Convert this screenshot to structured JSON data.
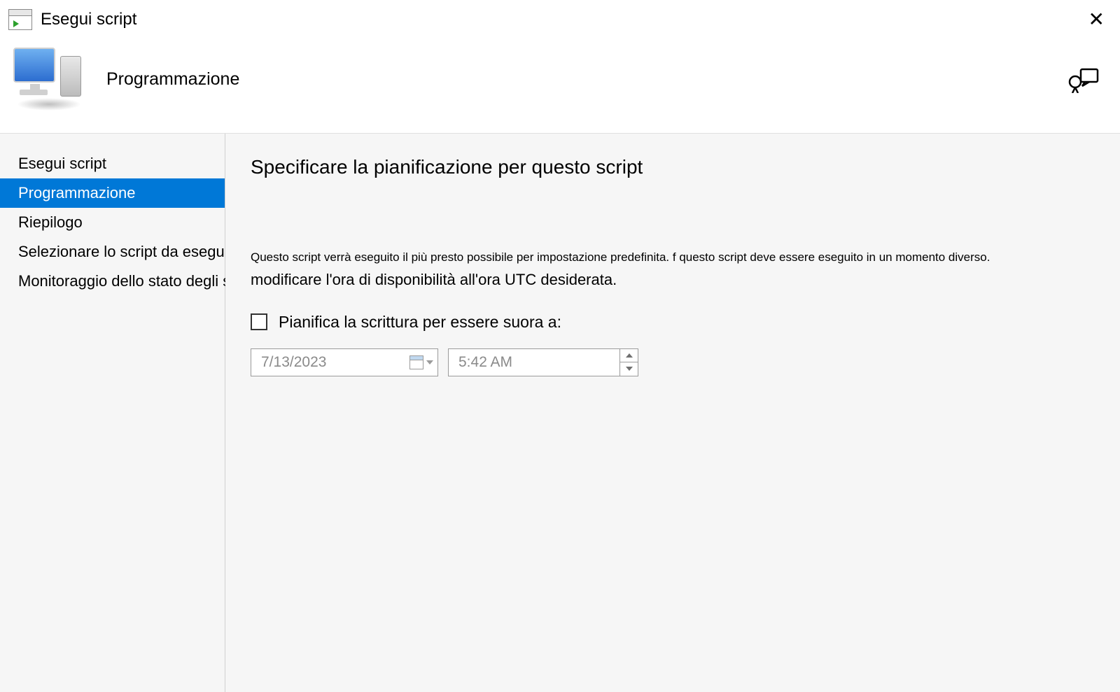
{
  "titlebar": {
    "title": "Esegui script"
  },
  "header": {
    "subtitle": "Programmazione"
  },
  "sidebar": {
    "items": [
      {
        "label": "Esegui script",
        "selected": false
      },
      {
        "label": "Programmazione",
        "selected": true
      },
      {
        "label": "Riepilogo",
        "selected": false
      },
      {
        "label": "Selezionare lo script da eseguire",
        "selected": false
      },
      {
        "label": "Monitoraggio dello stato degli script",
        "selected": false
      }
    ]
  },
  "content": {
    "heading": "Specificare la pianificazione per questo script",
    "desc_line1": "Questo script verrà eseguito il più presto possibile per impostazione predefinita. f questo script deve essere eseguito in un momento diverso.",
    "desc_line2": "modificare l'ora di disponibilità all'ora UTC desiderata.",
    "checkbox_label": "Pianifica la scrittura per essere suora a:",
    "checkbox_checked": false,
    "date_value": "7/13/2023",
    "time_value": "5:42 AM"
  }
}
